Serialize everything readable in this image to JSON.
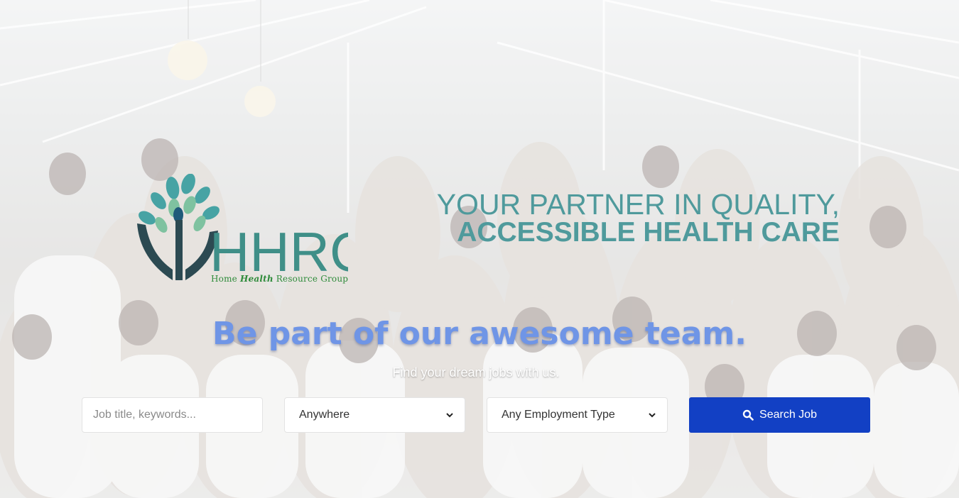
{
  "logo": {
    "letters": "HHRG",
    "subtitle_pre": "Home ",
    "subtitle_em": "Health",
    "subtitle_post": " Resource Group"
  },
  "tagline": {
    "line1": "YOUR PARTNER IN QUALITY,",
    "line2": "ACCESSIBLE HEALTH CARE"
  },
  "hero": {
    "headline": "Be part of our awesome team.",
    "subheadline": "Find your dream jobs with us."
  },
  "search": {
    "keyword_placeholder": "Job title, keywords...",
    "location_selected": "Anywhere",
    "employment_type_selected": "Any Employment Type",
    "button_label": "Search Job"
  },
  "colors": {
    "tagline": "#4f9a9c",
    "headline": "#6f95e6",
    "button": "#1240c4",
    "logo_teal": "#3f8f88",
    "logo_green": "#2e8b3a"
  }
}
